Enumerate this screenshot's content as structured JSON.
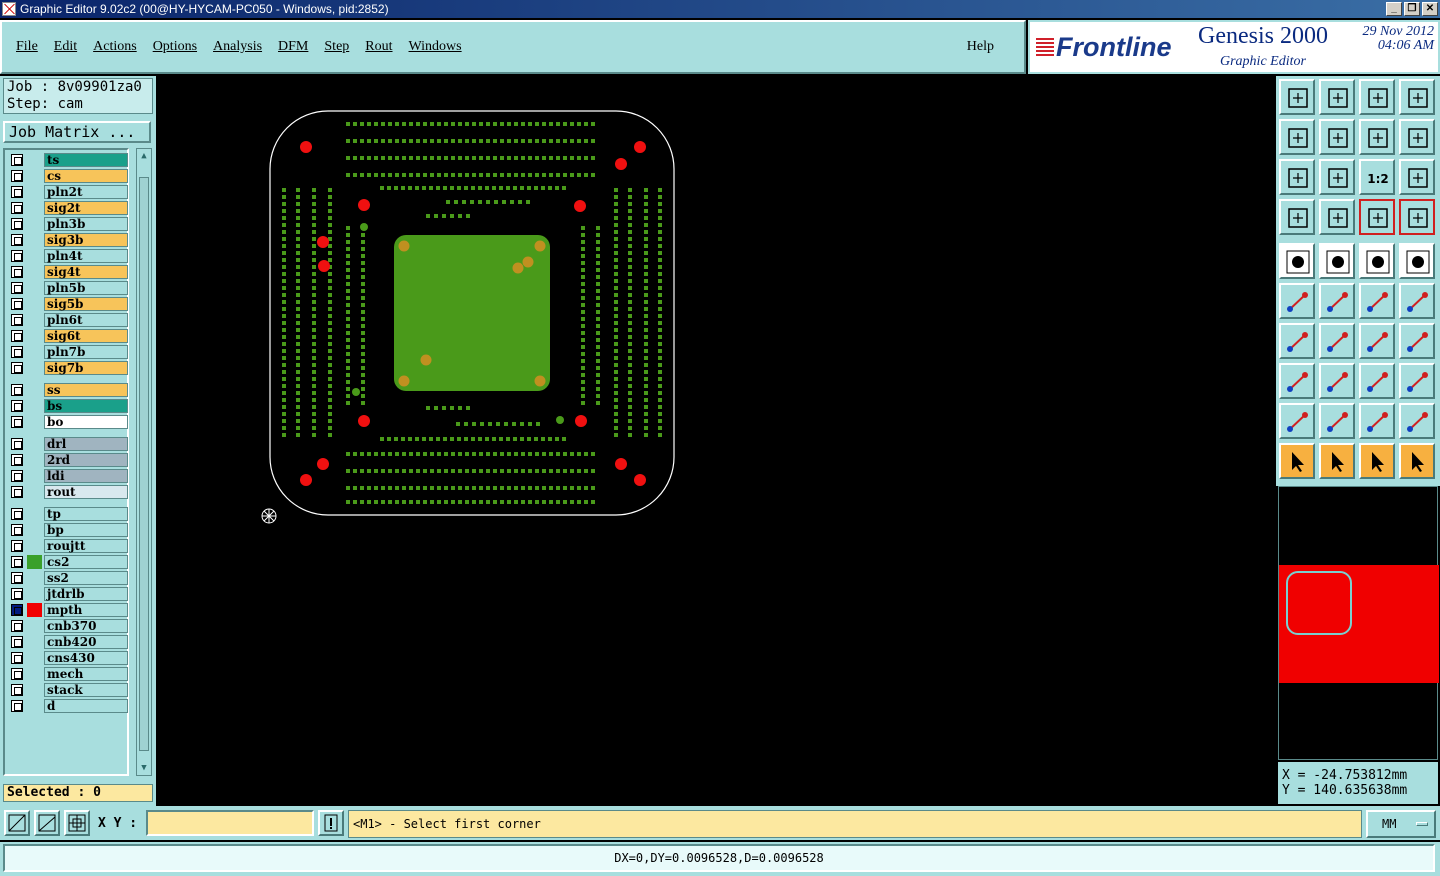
{
  "window": {
    "title": "Graphic Editor 9.02c2 (00@HY-HYCAM-PC050 - Windows, pid:2852)",
    "controls": [
      "_",
      "❐",
      "✕"
    ]
  },
  "menu": {
    "items": [
      {
        "label": "File"
      },
      {
        "label": "Edit"
      },
      {
        "label": "Actions"
      },
      {
        "label": "Options"
      },
      {
        "label": "Analysis"
      },
      {
        "label": "DFM"
      },
      {
        "label": "Step"
      },
      {
        "label": "Rout"
      },
      {
        "label": "Windows"
      }
    ],
    "help": "Help"
  },
  "brand": {
    "logo": "Frontline",
    "product": "Genesis 2000",
    "subtitle": "Graphic Editor",
    "date": "29 Nov 2012",
    "time": "04:06 AM"
  },
  "job": {
    "job_line": "Job : 8v09901za0",
    "step_line": "Step: cam",
    "matrix_button": "Job Matrix ..."
  },
  "layers": [
    {
      "name": "ts",
      "color": "#1aa08a"
    },
    {
      "name": "cs",
      "color": "#f7c45a"
    },
    {
      "name": "pln2t",
      "color": "#a8dede"
    },
    {
      "name": "sig2t",
      "color": "#f7c45a"
    },
    {
      "name": "pln3b",
      "color": "#a8dede"
    },
    {
      "name": "sig3b",
      "color": "#f7c45a"
    },
    {
      "name": "pln4t",
      "color": "#a8dede"
    },
    {
      "name": "sig4t",
      "color": "#f7c45a"
    },
    {
      "name": "pln5b",
      "color": "#a8dede"
    },
    {
      "name": "sig5b",
      "color": "#f7c45a"
    },
    {
      "name": "pln6t",
      "color": "#a8dede"
    },
    {
      "name": "sig6t",
      "color": "#f7c45a"
    },
    {
      "name": "pln7b",
      "color": "#a8dede"
    },
    {
      "name": "sig7b",
      "color": "#f7c45a"
    },
    {
      "name": "ss",
      "color": "#f7c45a"
    },
    {
      "name": "bs",
      "color": "#1aa08a"
    },
    {
      "name": "bo",
      "color": "#ffffff"
    },
    {
      "name": "drl",
      "color": "#a0b4c0"
    },
    {
      "name": "2rd",
      "color": "#a0b4c0"
    },
    {
      "name": "ldi",
      "color": "#a0b4c0"
    },
    {
      "name": "rout",
      "color": "#d8e8ee"
    },
    {
      "name": "tp",
      "color": "#a8dede"
    },
    {
      "name": "bp",
      "color": "#a8dede"
    },
    {
      "name": "roujtt",
      "color": "#a8dede"
    },
    {
      "name": "cs2",
      "color": "#a8dede",
      "swatch": "#3aa02a"
    },
    {
      "name": "ss2",
      "color": "#a8dede"
    },
    {
      "name": "jtdrlb",
      "color": "#a8dede"
    },
    {
      "name": "mpth",
      "color": "#a8dede",
      "swatch": "#f00000",
      "active": true
    },
    {
      "name": "cnb370",
      "color": "#a8dede"
    },
    {
      "name": "cnb420",
      "color": "#a8dede"
    },
    {
      "name": "cns430",
      "color": "#a8dede"
    },
    {
      "name": "mech",
      "color": "#a8dede"
    },
    {
      "name": "stack",
      "color": "#a8dede"
    },
    {
      "name": "d",
      "color": "#a8dede"
    }
  ],
  "selected": "Selected : 0",
  "coords": {
    "x": "X = -24.753812mm",
    "y": "Y = 140.635638mm"
  },
  "bottom": {
    "xy_label": "X Y :",
    "xy_value": "",
    "prompt": "<M1> - Select first corner",
    "units": "MM",
    "status": "DX=0,DY=0.0096528,D=0.0096528",
    "zoom_tool_label": "1:2"
  },
  "colors": {
    "panel": "#a8dede",
    "pad_red": "#f01010",
    "copper_green": "#4a9a1a",
    "via_gold": "#c09020"
  }
}
